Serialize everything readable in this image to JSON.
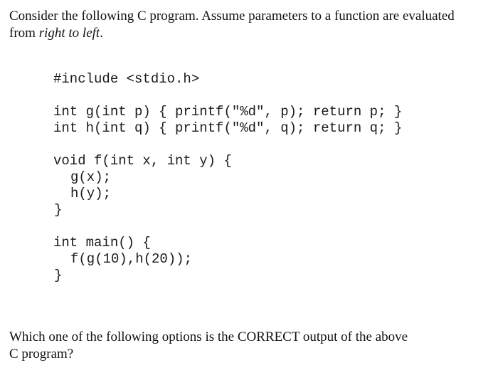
{
  "question": {
    "intro_text": "Consider the following C program. Assume parameters to a function are evaluated",
    "intro_line2_prefix": "from ",
    "intro_line2_emphasis": "right to left",
    "intro_line2_suffix": ".",
    "outro_line1": "Which one of the following options is the CORRECT output of the above",
    "outro_line2": "C program?"
  },
  "code": {
    "include": "#include <stdio.h>",
    "func_g": "int g(int p) { printf(\"%d\", p); return p; }",
    "func_h": "int h(int q) { printf(\"%d\", q); return q; }",
    "func_f_sig": "void f(int x, int y) {",
    "call_g": "g(x);",
    "call_h": "h(y);",
    "close_f": "}",
    "main_sig": "int main() {",
    "main_body": "f(g(10),h(20));",
    "close_main": "}"
  }
}
